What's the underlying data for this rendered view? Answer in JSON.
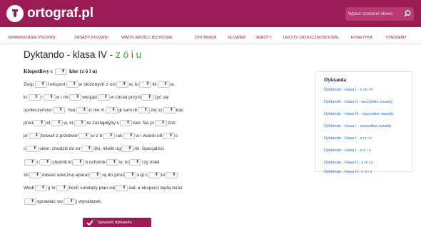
{
  "header": {
    "brand": "ortograf.pl",
    "search_placeholder": "Wpisz szukane słowo"
  },
  "nav": {
    "items": [
      "SPRAWDZANIE PISOWNI",
      "ZASADY PISOWNI",
      "WĄTPLIWOŚCI JĘZYKOWE",
      "DYKTANDA",
      "SŁOWNIK",
      "SKRÓTY",
      "TEKSTY OKOLICZNOŚCIOWE",
      "FONETYKA",
      "SYNONIMY"
    ]
  },
  "main": {
    "title_prefix": "Dyktando - klasa IV - ",
    "title_z": "z",
    "title_o": "ó",
    "title_i": "i",
    "title_u": "u",
    "subtitle": [
      "Kłopotliwy c",
      "kier (z ó i u)"
    ],
    "lines": [
      [
        "Zesp",
        "ł eksport",
        "w złożonych z osł",
        "w, kr",
        "lik",
        "w,"
      ],
      [
        "kr",
        "r",
        "w i mr",
        "wkojad",
        "w chciał przysł",
        "żyć się"
      ],
      [
        "społeczeństw",
        ". Nar",
        "d nie m",
        "gł sam dł",
        "żej sz",
        "kać"
      ],
      [
        "prod",
        "kt",
        "w, kt",
        "re zastąpiłyby c",
        "kier. Na pr",
        "żno"
      ],
      [
        "pr",
        "bowali z przetwor",
        "w z b",
        "rak",
        "w i wanilii utł",
        "c"
      ],
      [
        "c",
        "ukier, chodzili do wr",
        "żki, mielili og",
        "rki. Specjaliści"
      ],
      [
        "",
        "r",
        "chomili kl",
        "b ochotnk",
        "w, kt",
        "rzy mieli"
      ],
      [
        "zb",
        "dować wieczną aparat",
        "rę do prod",
        "kcji c",
        "kr",
        ""
      ],
      [
        "Wedł",
        "g kr",
        "tkich sondaży plan się",
        "dał, a eksperci będą teraz"
      ],
      [
        "",
        "sprawiać sw",
        "j wynalazek."
      ]
    ],
    "submit_label": "Sprawdź dyktando"
  },
  "sidebar": {
    "title": "Dyktanda",
    "links": [
      "Dyktando - klasa I - z ch i h",
      "Dyktando - klasa II - wszystkie zasady",
      "Dyktando - klasa III - wszystkie zasady",
      "Dyktando - klasa I - wszystkie zasady",
      "Dyktando - klasa I - z rz i ż",
      "Dyktando - klasa I - z ó i u",
      "Dyktando - klasa II - z rz i ż",
      "Dyktando - klasa II - z ó i u"
    ]
  },
  "colors": {
    "brand": "#9b1b56",
    "link": "#2d6ec9",
    "accent_green": "#3a9b3a",
    "accent_red": "#c22a2a"
  }
}
